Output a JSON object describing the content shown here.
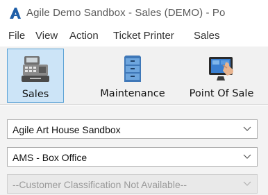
{
  "window": {
    "title": "Agile Demo Sandbox - Sales (DEMO) - Po",
    "logo_icon": "agile-logo-icon"
  },
  "menu": {
    "items": [
      {
        "label": "File"
      },
      {
        "label": "View"
      },
      {
        "label": "Action"
      },
      {
        "label": "Ticket Printer"
      },
      {
        "label": "Sales"
      }
    ]
  },
  "toolbar": {
    "buttons": [
      {
        "label": "Sales",
        "icon": "cash-register-icon",
        "active": true
      },
      {
        "label": "Maintenance",
        "icon": "file-cabinet-icon",
        "active": false
      },
      {
        "label": "Point Of Sale",
        "icon": "touch-screen-icon",
        "active": false
      }
    ]
  },
  "selectors": {
    "organization": {
      "value": "Agile Art House Sandbox"
    },
    "box_office": {
      "value": "AMS - Box Office"
    },
    "customer_classification": {
      "value": "--Customer Classification Not Available--",
      "disabled": true
    }
  },
  "colors": {
    "logo_blue": "#1f5fa8",
    "active_button_bg": "#cce4f7",
    "active_button_border": "#5da3d6"
  }
}
